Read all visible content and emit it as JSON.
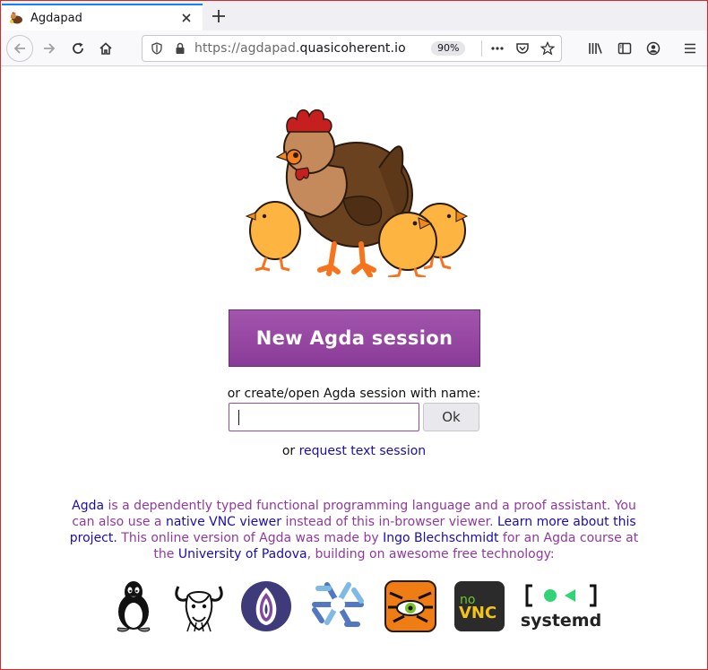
{
  "browser": {
    "tab": {
      "title": "Agdapad"
    },
    "url": {
      "prefix": "https://agdapad.",
      "domain": "quasicoherent.io"
    },
    "zoom": "90%"
  },
  "page": {
    "new_session_label": "New Agda session",
    "or_create_text": "or create/open Agda session with name:",
    "name_input_value": "",
    "ok_label": "Ok",
    "or_text": "or",
    "request_text_link": "request text session",
    "description": {
      "p1_link": "Agda",
      "p2": " is a dependently typed functional programming language and a proof assistant. You can also use a ",
      "p3_link": "native VNC viewer",
      "p4": " instead of this in-browser viewer. ",
      "p5_link": "Learn more about this project.",
      "p6": " This online version of Agda was made by ",
      "p7_link": "Ingo Blechschmidt",
      "p8": " for an Agda course at the ",
      "p9_link": "University of Padova",
      "p10": ", building on awesome free technology:"
    },
    "logos": {
      "novnc_text_top": "no",
      "novnc_text_bottom": "VNC",
      "systemd_text": "systemd"
    }
  },
  "colors": {
    "accent_purple": "#8f3a9c",
    "link_blue": "#1a0dab",
    "tab_accent": "#0a84ff"
  },
  "icons": [
    "hen-favicon",
    "close-icon",
    "plus-icon",
    "back-arrow-icon",
    "forward-arrow-icon",
    "reload-icon",
    "home-icon",
    "shield-icon",
    "lock-icon",
    "more-icon",
    "pocket-icon",
    "star-icon",
    "library-icon",
    "sidebar-icon",
    "account-icon",
    "menu-icon"
  ]
}
